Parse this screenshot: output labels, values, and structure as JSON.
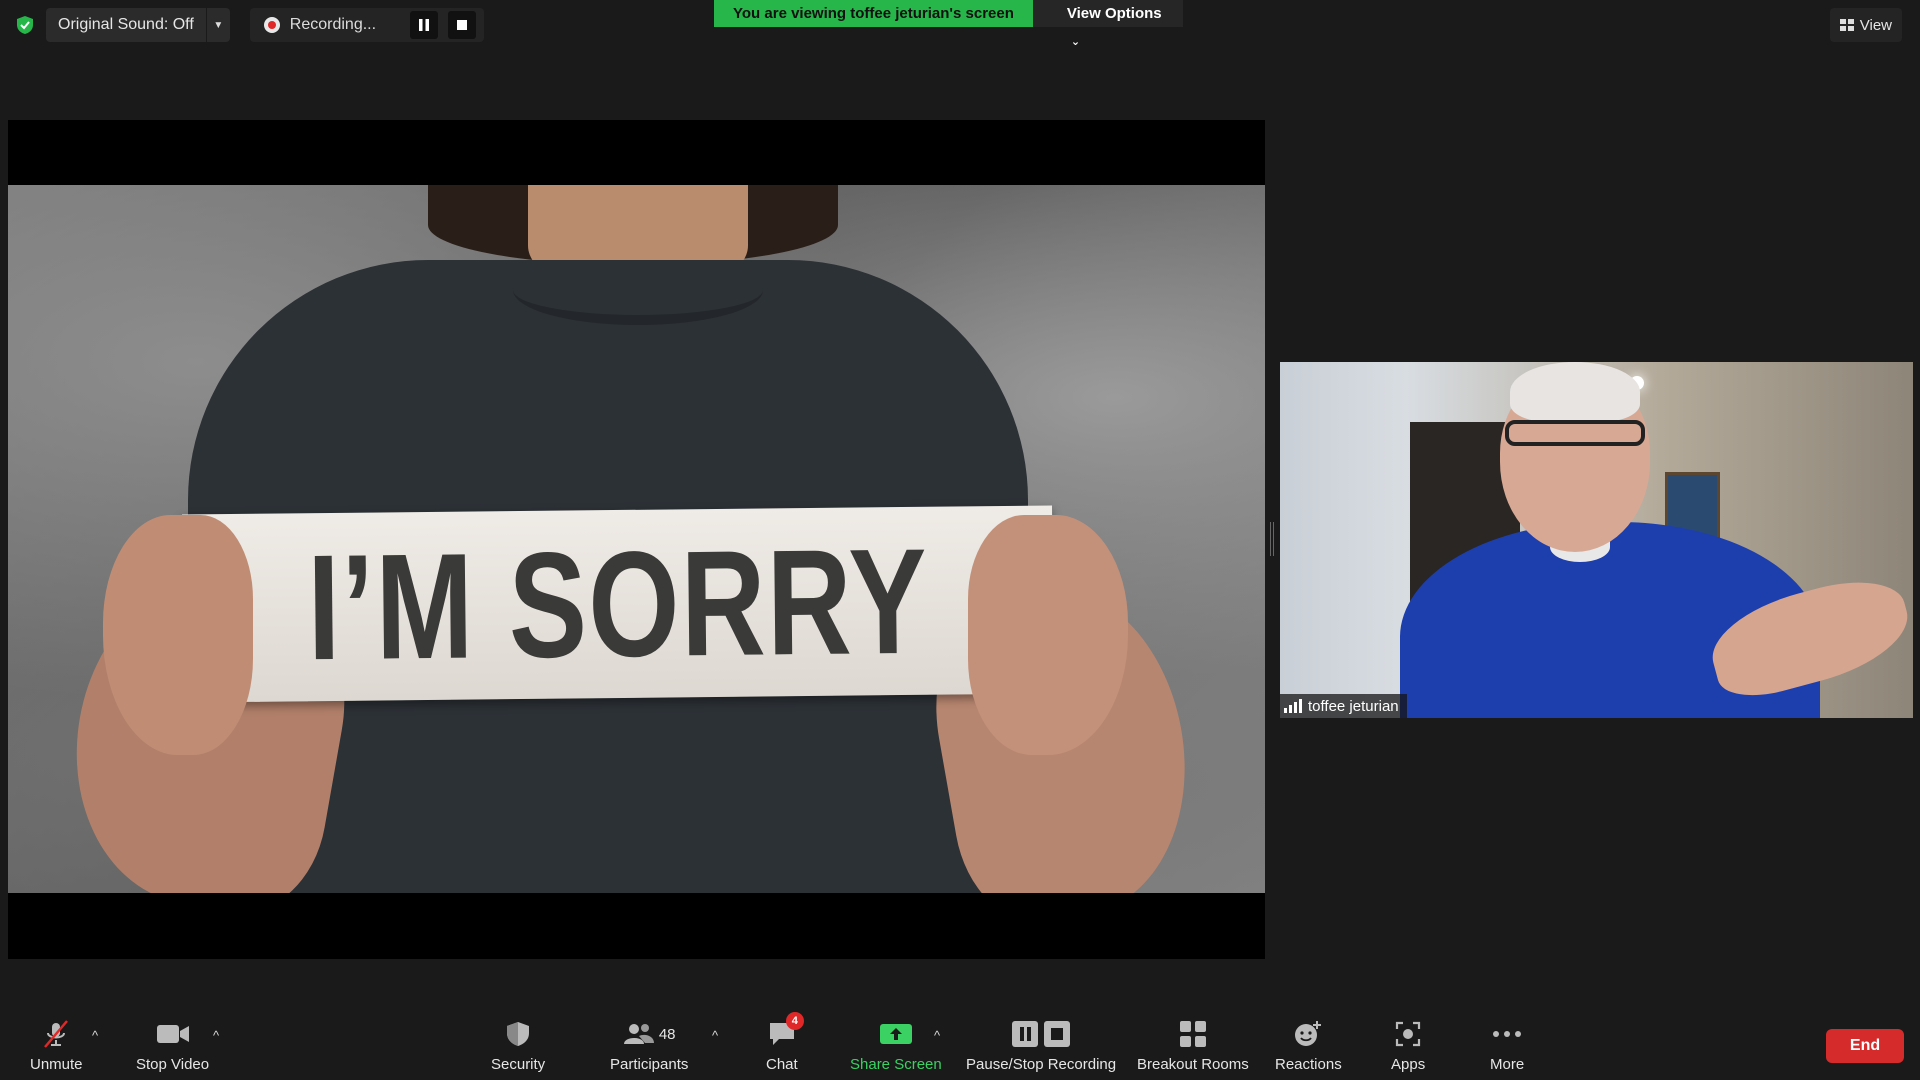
{
  "top_bar": {
    "original_sound_label": "Original Sound: Off",
    "recording_label": "Recording...",
    "viewing_banner": "You are viewing toffee jeturian's screen",
    "view_options_label": "View Options",
    "view_label": "View"
  },
  "shared_screen": {
    "sign_text": "I’M SORRY"
  },
  "participant": {
    "name": "toffee jeturian"
  },
  "toolbar": {
    "unmute": "Unmute",
    "stop_video": "Stop Video",
    "security": "Security",
    "participants": "Participants",
    "participants_count": "48",
    "chat": "Chat",
    "chat_badge": "4",
    "share_screen": "Share Screen",
    "pause_stop_recording": "Pause/Stop Recording",
    "breakout_rooms": "Breakout Rooms",
    "reactions": "Reactions",
    "apps": "Apps",
    "more": "More",
    "end": "End"
  },
  "colors": {
    "banner_green": "#27b64a",
    "share_green": "#3bd163",
    "end_red": "#d62b2b",
    "background": "#1a1a1a"
  }
}
